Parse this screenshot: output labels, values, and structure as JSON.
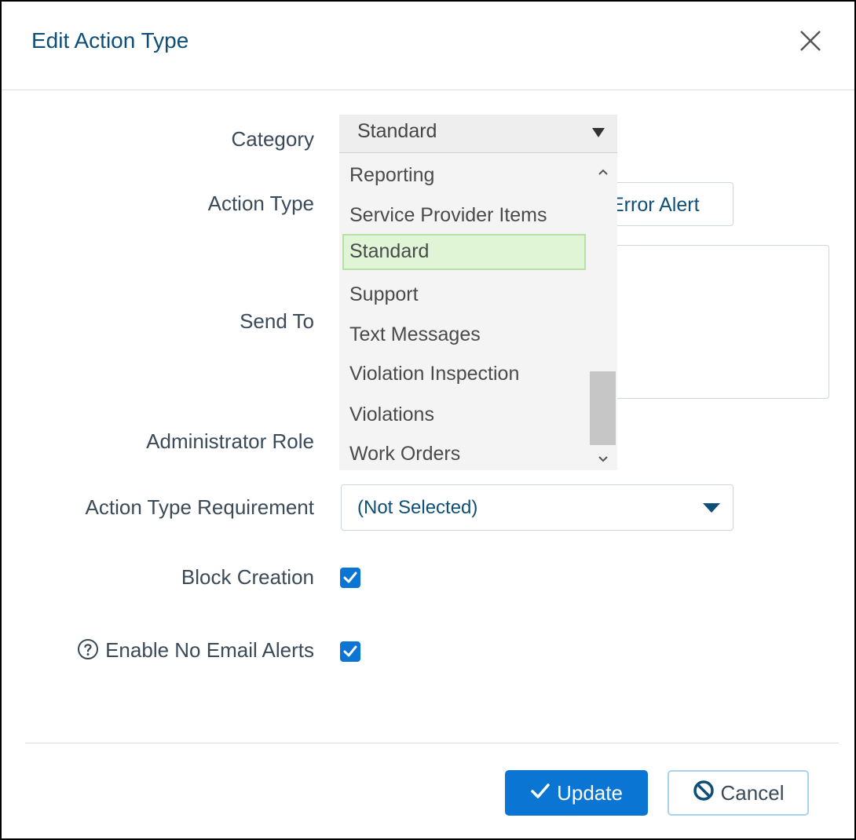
{
  "dialog": {
    "title": "Edit Action Type",
    "close_icon": "close-icon"
  },
  "fields": {
    "category": {
      "label": "Category",
      "value": "Standard",
      "options": [
        "Reporting",
        "Service Provider Items",
        "Standard",
        "Support",
        "Text Messages",
        "Violation Inspection",
        "Violations",
        "Work Orders"
      ],
      "highlighted": "Standard"
    },
    "action_type": {
      "label": "Action Type",
      "value_visible": "Error Alert"
    },
    "send_to": {
      "label": "Send To",
      "value": ""
    },
    "administrator_role": {
      "label": "Administrator Role"
    },
    "action_type_requirement": {
      "label": "Action Type Requirement",
      "value": "(Not Selected)"
    },
    "block_creation": {
      "label": "Block Creation",
      "checked": true
    },
    "enable_no_email_alerts": {
      "label": "Enable No Email Alerts",
      "checked": true,
      "help_icon": "question-circle-icon"
    }
  },
  "buttons": {
    "update_label": "Update",
    "update_icon": "check-icon",
    "cancel_label": "Cancel",
    "cancel_icon": "ban-icon"
  },
  "colors": {
    "primary": "#0b75d4",
    "title": "#0e4f7a",
    "selected_option_bg": "#dff5d6"
  }
}
